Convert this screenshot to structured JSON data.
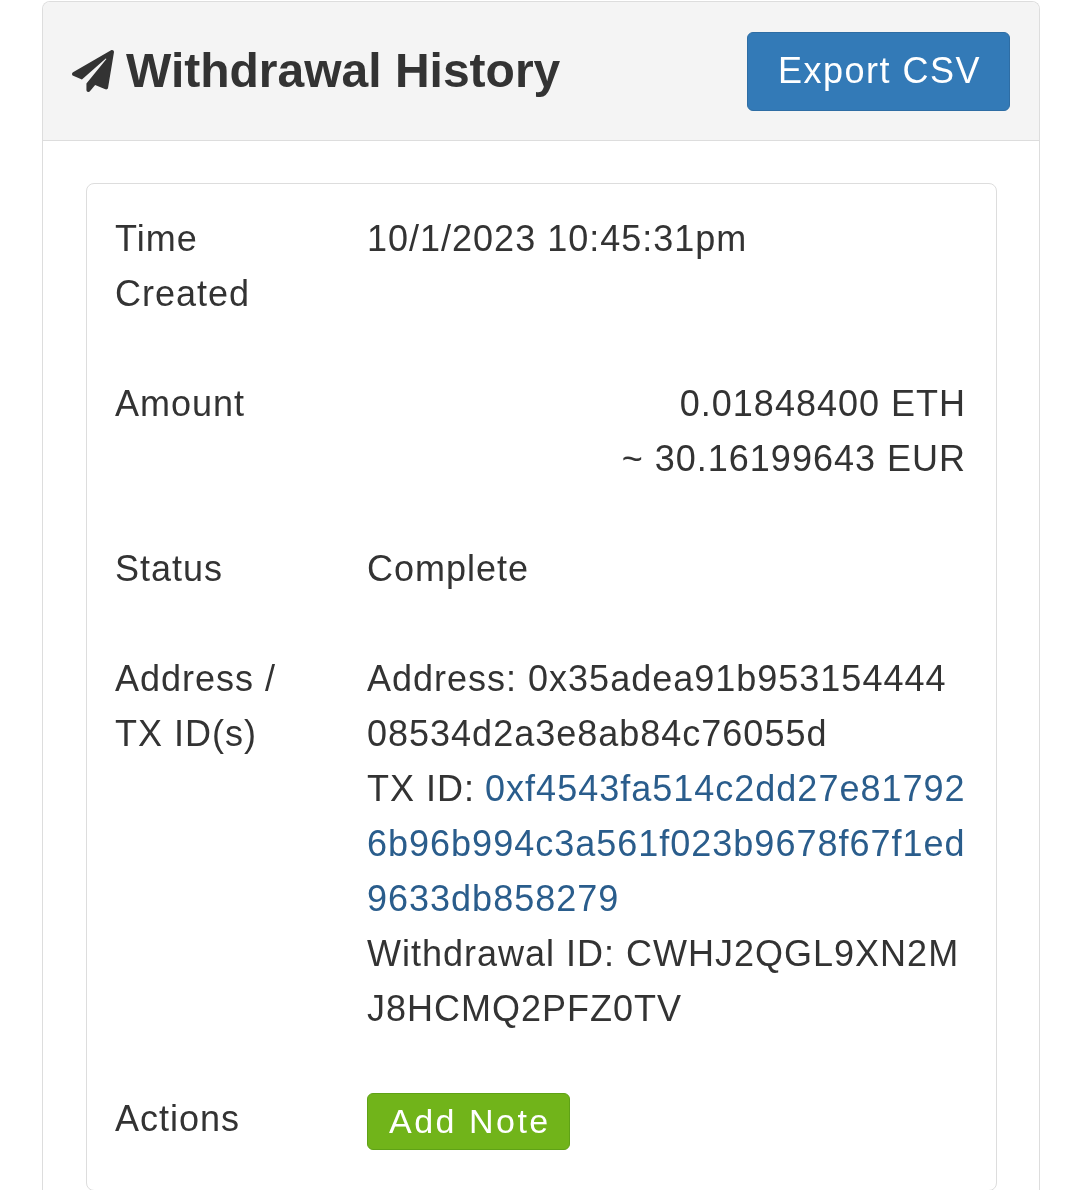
{
  "header": {
    "title": "Withdrawal History",
    "buttons": [
      "Export CSV"
    ]
  },
  "details": [
    {
      "kind": "text",
      "label": "Time Created",
      "value": "10/1/2023 10:45:31pm"
    },
    {
      "kind": "amount",
      "label": "Amount",
      "lines": [
        "0.01848400 ETH",
        "~ 30.16199643 EUR"
      ]
    },
    {
      "kind": "text",
      "label": "Status",
      "value": "Complete"
    },
    {
      "kind": "ids",
      "label": "Address / TX ID(s)",
      "entries": [
        {
          "kind": "address",
          "text": "Address: 0x35adea91b95315444408534d2a3e8ab84c76055d"
        },
        {
          "kind": "transaction",
          "label": "TX ID:",
          "link": "0xf4543fa514c2dd27e817926b96b994c3a561f023b9678f67f1ed9633db858279"
        },
        {
          "kind": "withdrawal",
          "text": "Withdrawal ID: CWHJ2QGL9XN2MJ8HCMQ2PFZ0TV"
        }
      ]
    },
    {
      "kind": "actions",
      "label": "Actions",
      "buttons": [
        "Add Note"
      ]
    }
  ]
}
